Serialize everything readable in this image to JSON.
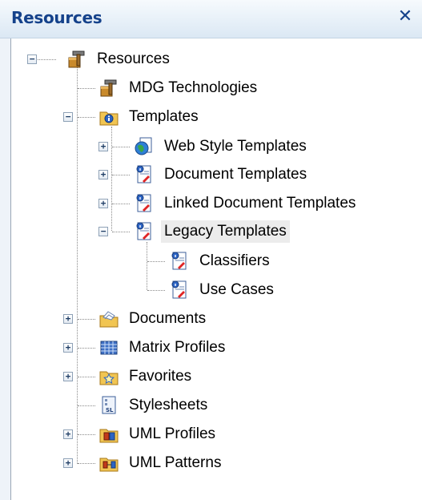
{
  "panel": {
    "title": "Resources",
    "close_glyph": "✕"
  },
  "tree": {
    "root": {
      "label": "Resources",
      "icon": "hammer-box-icon",
      "expanded": true
    },
    "children": [
      {
        "label": "MDG Technologies",
        "icon": "hammer-box-icon"
      },
      {
        "label": "Templates",
        "icon": "folder-info-icon",
        "expanded": true
      },
      {
        "label": "Web Style Templates",
        "icon": "globe-document-icon"
      },
      {
        "label": "Document Templates",
        "icon": "document-template-icon"
      },
      {
        "label": "Linked Document Templates",
        "icon": "document-template-icon"
      },
      {
        "label": "Legacy Templates",
        "icon": "document-template-icon",
        "expanded": true,
        "selected": true
      },
      {
        "label": "Classifiers",
        "icon": "document-template-icon"
      },
      {
        "label": "Use Cases",
        "icon": "document-template-icon"
      },
      {
        "label": "Documents",
        "icon": "documents-folder-icon"
      },
      {
        "label": "Matrix Profiles",
        "icon": "matrix-grid-icon"
      },
      {
        "label": "Favorites",
        "icon": "favorites-folder-icon"
      },
      {
        "label": "Stylesheets",
        "icon": "stylesheet-icon"
      },
      {
        "label": "UML Profiles",
        "icon": "uml-profile-icon"
      },
      {
        "label": "UML Patterns",
        "icon": "uml-pattern-icon"
      }
    ]
  },
  "colors": {
    "title_text": "#15428b",
    "selection_bg": "#ececec",
    "tree_line": "#8a8a8a"
  }
}
